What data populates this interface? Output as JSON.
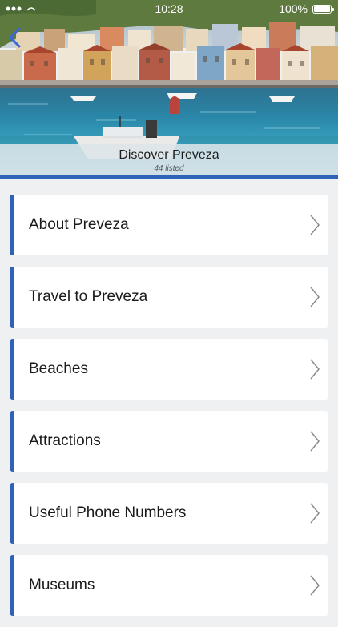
{
  "status_bar": {
    "time": "10:28",
    "battery": "100%"
  },
  "header": {
    "title": "Discover Preveza",
    "subtitle": "44 listed",
    "back_icon": "chevron-left-icon",
    "accent_color": "#2f63b8"
  },
  "menu": {
    "items": [
      {
        "label": "About Preveza",
        "icon": "chevron-right-icon"
      },
      {
        "label": "Travel to Preveza",
        "icon": "chevron-right-icon"
      },
      {
        "label": "Beaches",
        "icon": "chevron-right-icon"
      },
      {
        "label": "Attractions",
        "icon": "chevron-right-icon"
      },
      {
        "label": "Useful Phone Numbers",
        "icon": "chevron-right-icon"
      },
      {
        "label": "Museums",
        "icon": "chevron-right-icon"
      }
    ]
  }
}
